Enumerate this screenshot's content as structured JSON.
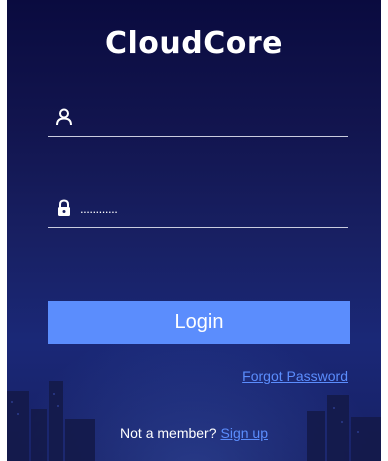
{
  "app": {
    "logo_text": "CloudCore"
  },
  "form": {
    "username": {
      "icon": "user-icon",
      "value": "",
      "placeholder": ""
    },
    "password": {
      "icon": "lock-icon",
      "value": "............"
    },
    "login_label": "Login",
    "forgot_label": "Forgot Password"
  },
  "footer": {
    "prompt": "Not a member?",
    "signup_label": "Sign up"
  },
  "colors": {
    "accent": "#5b8dfd",
    "background_top": "#0a0b3f",
    "background_bottom": "#1a2877",
    "text": "#ffffff"
  }
}
